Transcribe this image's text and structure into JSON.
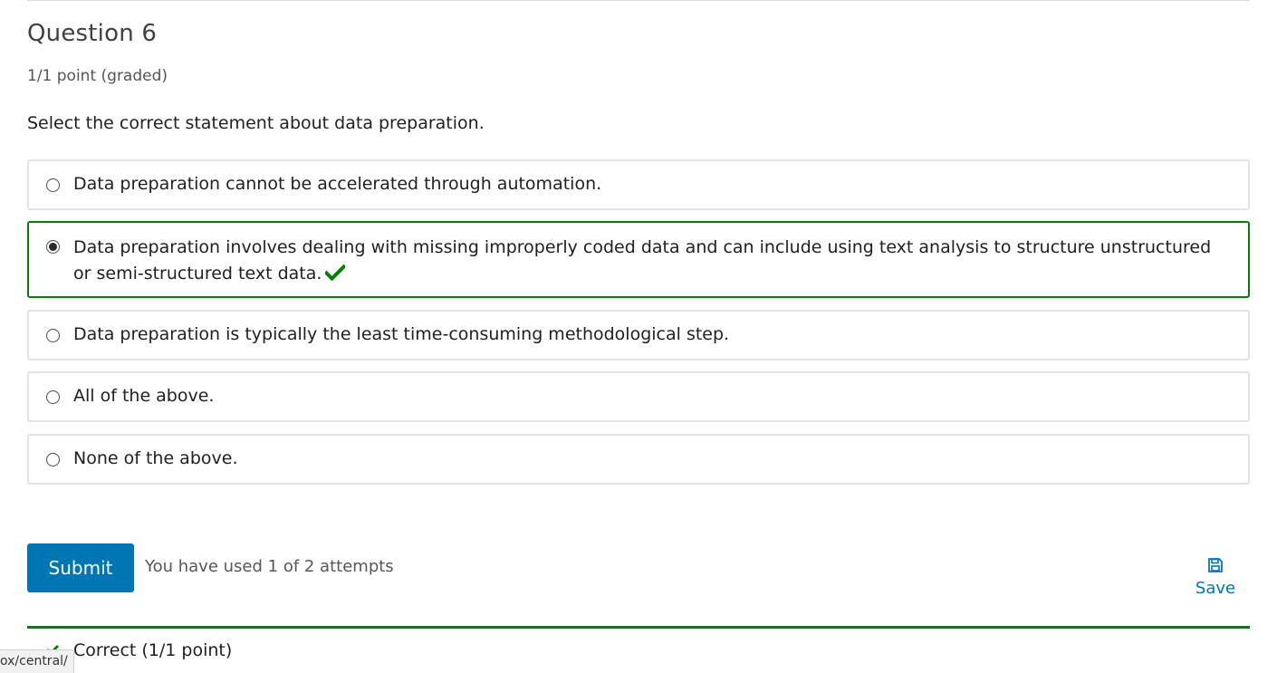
{
  "question": {
    "title": "Question 6",
    "points": "1/1 point (graded)",
    "prompt": "Select the correct statement about data preparation."
  },
  "options": [
    {
      "text": "Data preparation cannot be accelerated through automation.",
      "selected": false,
      "correct": false
    },
    {
      "text": "Data preparation involves dealing with missing improperly coded data and can include using text analysis to structure unstructured or semi-structured text data.",
      "selected": true,
      "correct": true
    },
    {
      "text": "Data preparation is typically the least time-consuming methodological step.",
      "selected": false,
      "correct": false
    },
    {
      "text": "All of the above.",
      "selected": false,
      "correct": false
    },
    {
      "text": "None of the above.",
      "selected": false,
      "correct": false
    }
  ],
  "actions": {
    "submit_label": "Submit",
    "attempts_text": "You have used 1 of 2 attempts",
    "save_label": "Save",
    "save_icon": "floppy-disk-icon"
  },
  "result": {
    "text": "Correct (1/1 point)",
    "icon": "check-icon"
  },
  "status_bar": {
    "url_fragment": "ox/central/"
  },
  "colors": {
    "correct_green": "#008100",
    "accent_blue": "#0075b4",
    "option_border": "#e3e3e3"
  }
}
